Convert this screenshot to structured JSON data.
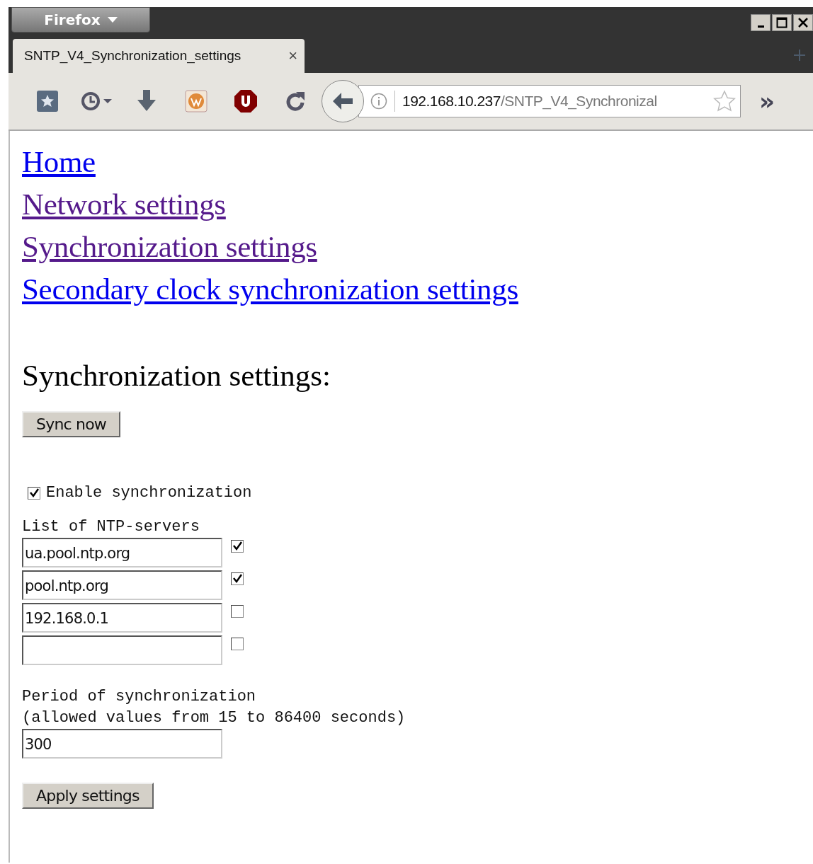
{
  "browser": {
    "menu_button": "Firefox",
    "tab": {
      "title": "SNTP_V4_Synchronization_settings",
      "close": "×",
      "selected": true
    },
    "url": {
      "host": "192.168.10.237",
      "path": "/SNTP_V4_Synchronizal"
    },
    "overflow": "»"
  },
  "links": [
    {
      "label": "Home",
      "visited": false
    },
    {
      "label": "Network settings",
      "visited": true
    },
    {
      "label": "Synchronization settings",
      "visited": true
    },
    {
      "label": "Secondary clock synchronization settings",
      "visited": false
    }
  ],
  "heading": "Synchronization settings:",
  "sync_button": "Sync now",
  "enable": {
    "label": "Enable synchronization",
    "checked": true
  },
  "servers_label": "List of NTP-servers",
  "servers": [
    {
      "value": "ua.pool.ntp.org",
      "checked": true
    },
    {
      "value": "pool.ntp.org",
      "checked": true
    },
    {
      "value": "192.168.0.1",
      "checked": false
    },
    {
      "checked": false
    }
  ],
  "period_label": "Period of synchronization",
  "period_hint": "(allowed values from 15 to 86400 seconds)",
  "period_value": "300",
  "apply_button": "Apply settings"
}
